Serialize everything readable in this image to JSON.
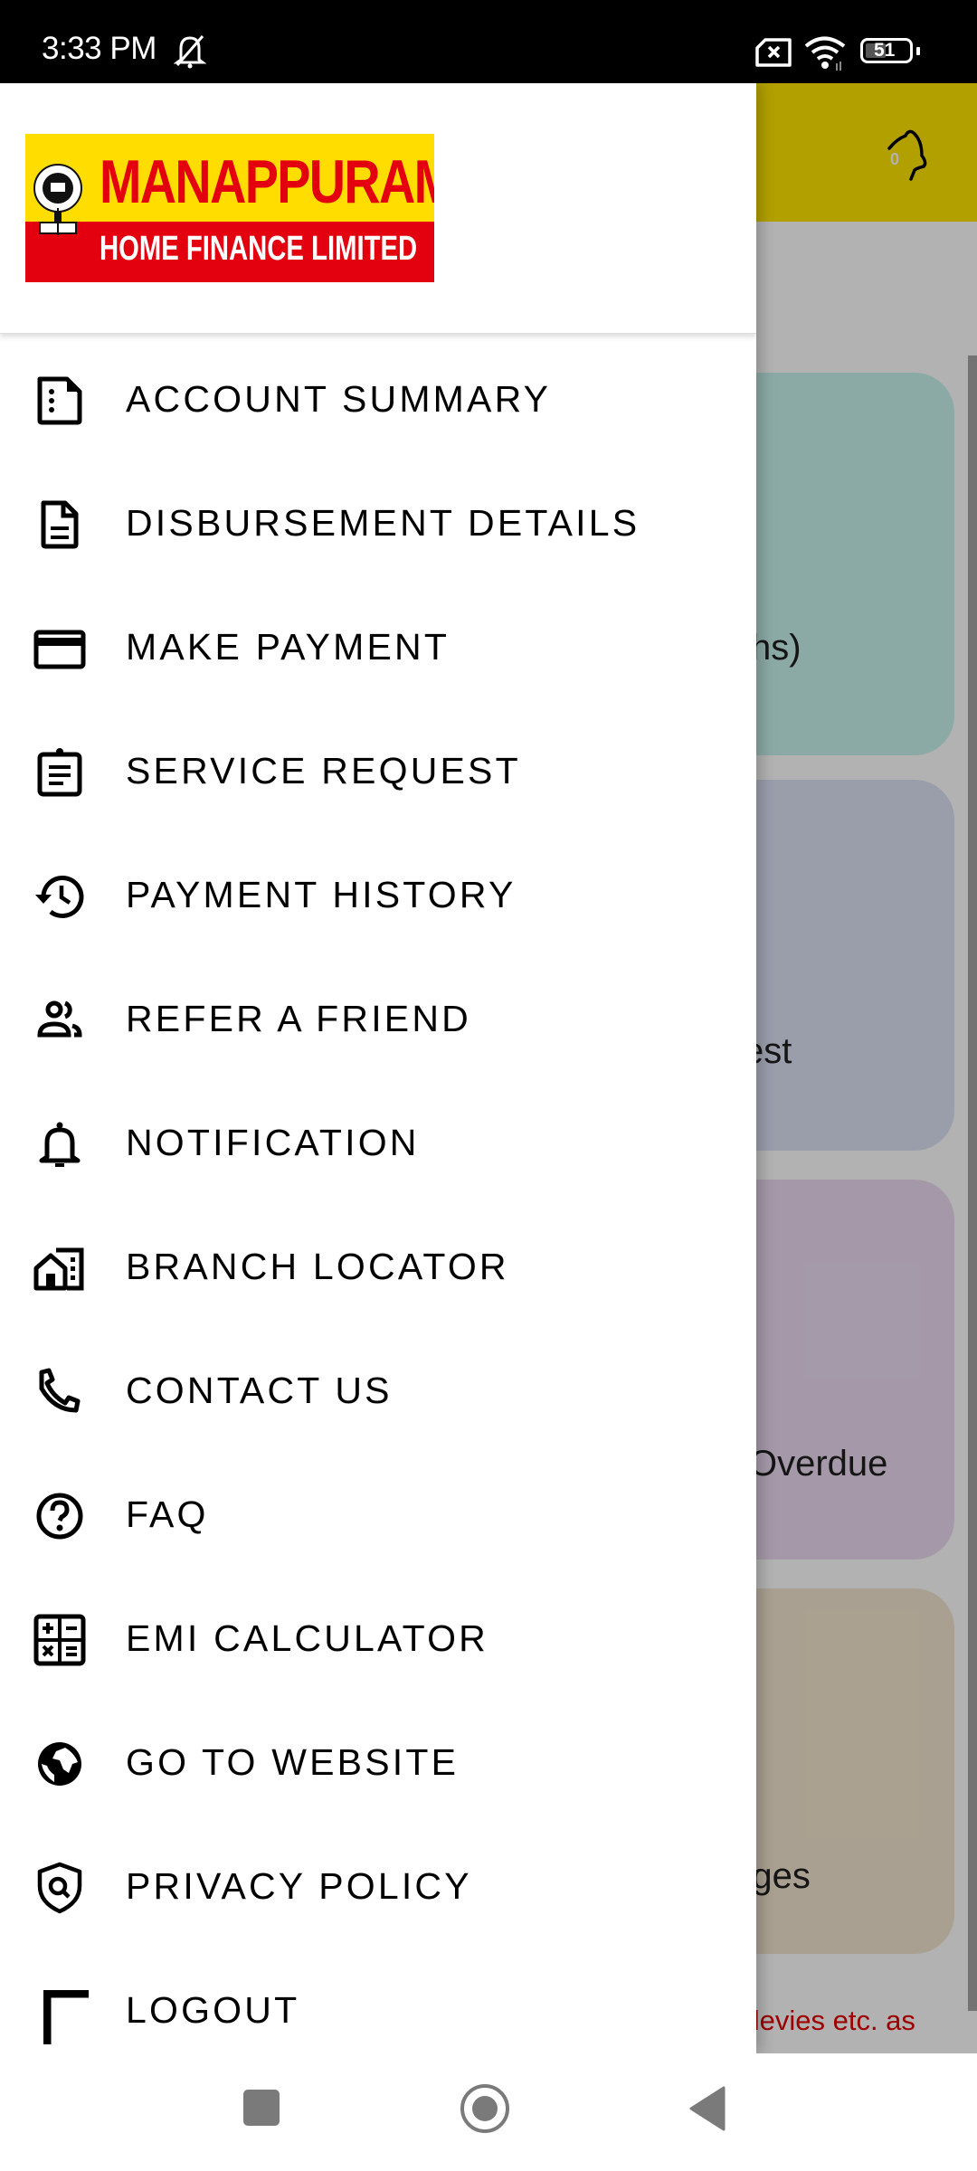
{
  "status_bar": {
    "time": "3:33 PM",
    "icons": [
      "notifications-muted-icon",
      "no-sim-icon",
      "wifi-icon",
      "battery-icon"
    ],
    "battery_level": "51"
  },
  "background_app": {
    "header_color": "#ffe600",
    "notification_count": "0",
    "cards": [
      {
        "text_fragment": "hs)",
        "color": "#c8f3ec"
      },
      {
        "text_fragment": "est",
        "color": "#dde3f5"
      },
      {
        "text_fragment": "Overdue",
        "color": "#ecdcf3"
      },
      {
        "text_fragment": "rges",
        "color": "#f3e6d0"
      }
    ],
    "disclaimer_fragment": "s, levies etc. as"
  },
  "drawer": {
    "logo": {
      "brand": "MANAPPURAM",
      "subtitle": "HOME FINANCE LIMITED",
      "colors": {
        "yellow": "#ffdd00",
        "red": "#e3000f"
      }
    },
    "menu_items": [
      {
        "label": "ACCOUNT SUMMARY",
        "icon": "account-summary-icon"
      },
      {
        "label": "DISBURSEMENT DETAILS",
        "icon": "document-icon"
      },
      {
        "label": "MAKE PAYMENT",
        "icon": "credit-card-icon"
      },
      {
        "label": "SERVICE REQUEST",
        "icon": "clipboard-icon"
      },
      {
        "label": "PAYMENT HISTORY",
        "icon": "history-icon"
      },
      {
        "label": "REFER A FRIEND",
        "icon": "people-icon"
      },
      {
        "label": "NOTIFICATION",
        "icon": "bell-icon"
      },
      {
        "label": "BRANCH LOCATOR",
        "icon": "building-icon"
      },
      {
        "label": "CONTACT US",
        "icon": "phone-icon"
      },
      {
        "label": "FAQ",
        "icon": "help-circle-icon"
      },
      {
        "label": "EMI CALCULATOR",
        "icon": "calculator-icon"
      },
      {
        "label": "GO TO WEBSITE",
        "icon": "globe-icon"
      },
      {
        "label": "PRIVACY POLICY",
        "icon": "shield-search-icon"
      },
      {
        "label": "LOGOUT",
        "icon": "logout-icon"
      }
    ]
  },
  "nav_bar": {
    "buttons": [
      "recents-button",
      "home-button",
      "back-button"
    ]
  }
}
